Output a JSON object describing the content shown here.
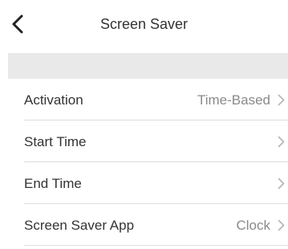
{
  "nav": {
    "back_icon": "chevron-left-icon",
    "title": "Screen Saver"
  },
  "settings": {
    "rows": [
      {
        "label": "Activation",
        "value": "Time-Based"
      },
      {
        "label": "Start Time",
        "value": ""
      },
      {
        "label": "End Time",
        "value": ""
      },
      {
        "label": "Screen Saver App",
        "value": "Clock"
      }
    ],
    "chevron_icon": "chevron-right-icon"
  },
  "colors": {
    "text": "#333333",
    "value_text": "#8a8a8a",
    "section_gap": "#e9e9e9",
    "divider": "#dcdcdc"
  }
}
